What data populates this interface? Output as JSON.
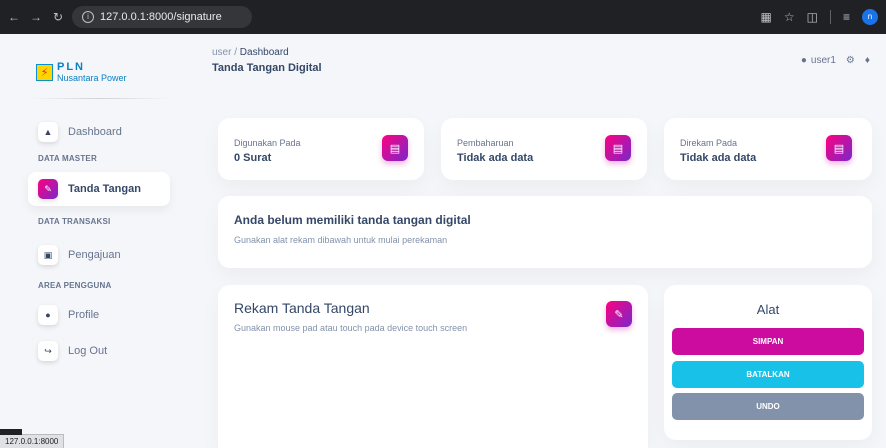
{
  "browser": {
    "url": "127.0.0.1:8000/signature",
    "status_url": "127.0.0.1:8000"
  },
  "brand": {
    "name": "PLN",
    "sub": "Nusantara Power"
  },
  "sidebar": {
    "dashboard": "Dashboard",
    "section_master": "DATA MASTER",
    "tanda_tangan": "Tanda Tangan",
    "section_transaksi": "DATA TRANSAKSI",
    "pengajuan": "Pengajuan",
    "section_area": "AREA PENGGUNA",
    "profile": "Profile",
    "logout": "Log Out"
  },
  "header": {
    "crumb_root": "user",
    "crumb_sep": "/",
    "crumb_current": "Dashboard",
    "title": "Tanda Tangan Digital",
    "username": "user1"
  },
  "stats": [
    {
      "label": "Digunakan Pada",
      "value": "0 Surat"
    },
    {
      "label": "Pembaharuan",
      "value": "Tidak ada data"
    },
    {
      "label": "Direkam Pada",
      "value": "Tidak ada data"
    }
  ],
  "notice": {
    "title": "Anda belum memiliki tanda tangan digital",
    "subtitle": "Gunakan alat rekam dibawah untuk mulai perekaman"
  },
  "rekam": {
    "title": "Rekam Tanda Tangan",
    "subtitle": "Gunakan mouse pad atau touch pada device touch screen"
  },
  "alat": {
    "title": "Alat",
    "simpan": "SIMPAN",
    "batalkan": "BATALKAN",
    "undo": "UNDO"
  },
  "colors": {
    "primary": "#cb0c9f",
    "info": "#17c1e8",
    "secondary": "#8392ab",
    "text": "#344767"
  },
  "icons": {
    "stat": "document-stack-icon",
    "rekam": "signature-pen-icon"
  }
}
